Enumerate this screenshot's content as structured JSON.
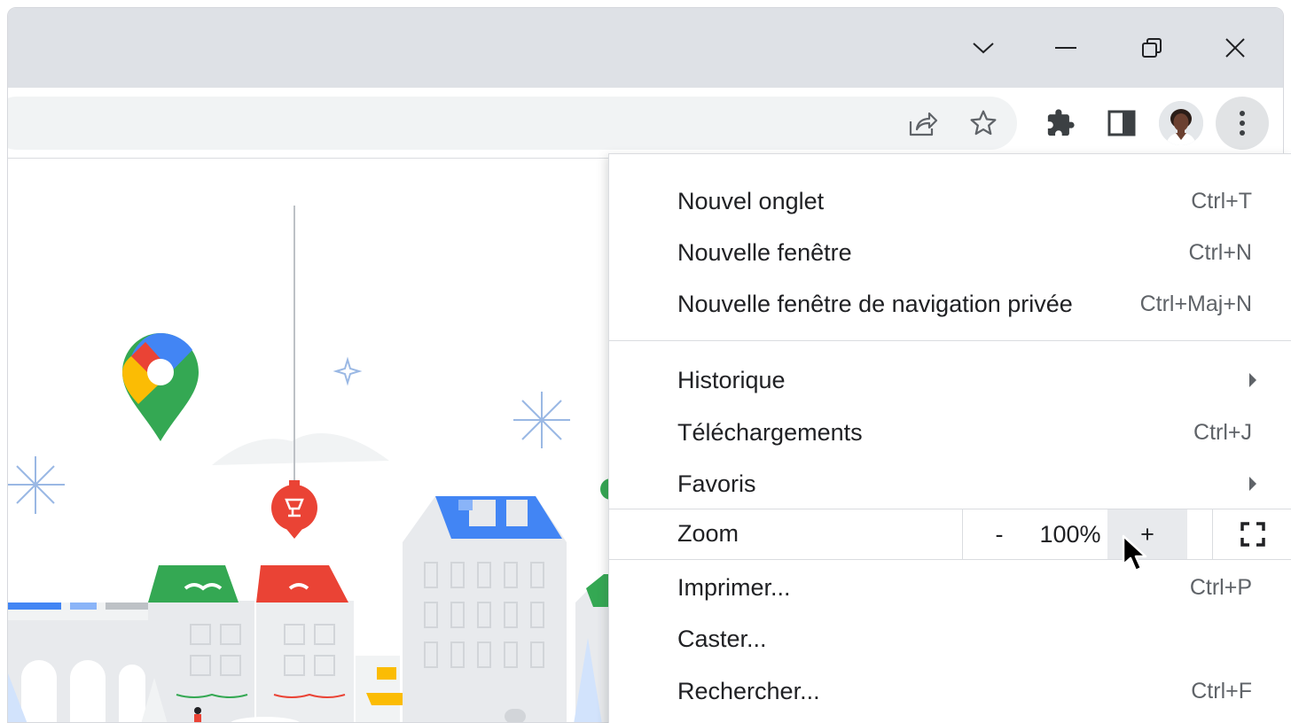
{
  "window": {
    "controls": {
      "tab_search": "chevron-down-icon",
      "minimize": "minimize-icon",
      "restore": "restore-icon",
      "close": "close-icon"
    }
  },
  "toolbar": {
    "icons": [
      "share-icon",
      "star-icon",
      "extensions-icon",
      "side-panel-icon",
      "profile-avatar",
      "more-menu-icon"
    ]
  },
  "menu": {
    "group1": [
      {
        "label": "Nouvel onglet",
        "shortcut": "Ctrl+T"
      },
      {
        "label": "Nouvelle fenêtre",
        "shortcut": "Ctrl+N"
      },
      {
        "label": "Nouvelle fenêtre de navigation privée",
        "shortcut": "Ctrl+Maj+N"
      }
    ],
    "group2": [
      {
        "label": "Historique",
        "shortcut": ""
      },
      {
        "label": "Téléchargements",
        "shortcut": "Ctrl+J"
      },
      {
        "label": "Favoris",
        "shortcut": ""
      }
    ],
    "zoom": {
      "label": "Zoom",
      "minus": "-",
      "value": "100%",
      "plus": "+"
    },
    "group3": [
      {
        "label": "Imprimer...",
        "shortcut": "Ctrl+P"
      },
      {
        "label": "Caster...",
        "shortcut": ""
      },
      {
        "label": "Rechercher...",
        "shortcut": "Ctrl+F"
      }
    ]
  },
  "colors": {
    "titlebar": "#dee1e6",
    "omnibox": "#f1f3f4",
    "maps_red": "#ea4335",
    "maps_blue": "#4285f4",
    "maps_yellow": "#fbbc04",
    "maps_green": "#34a853"
  }
}
